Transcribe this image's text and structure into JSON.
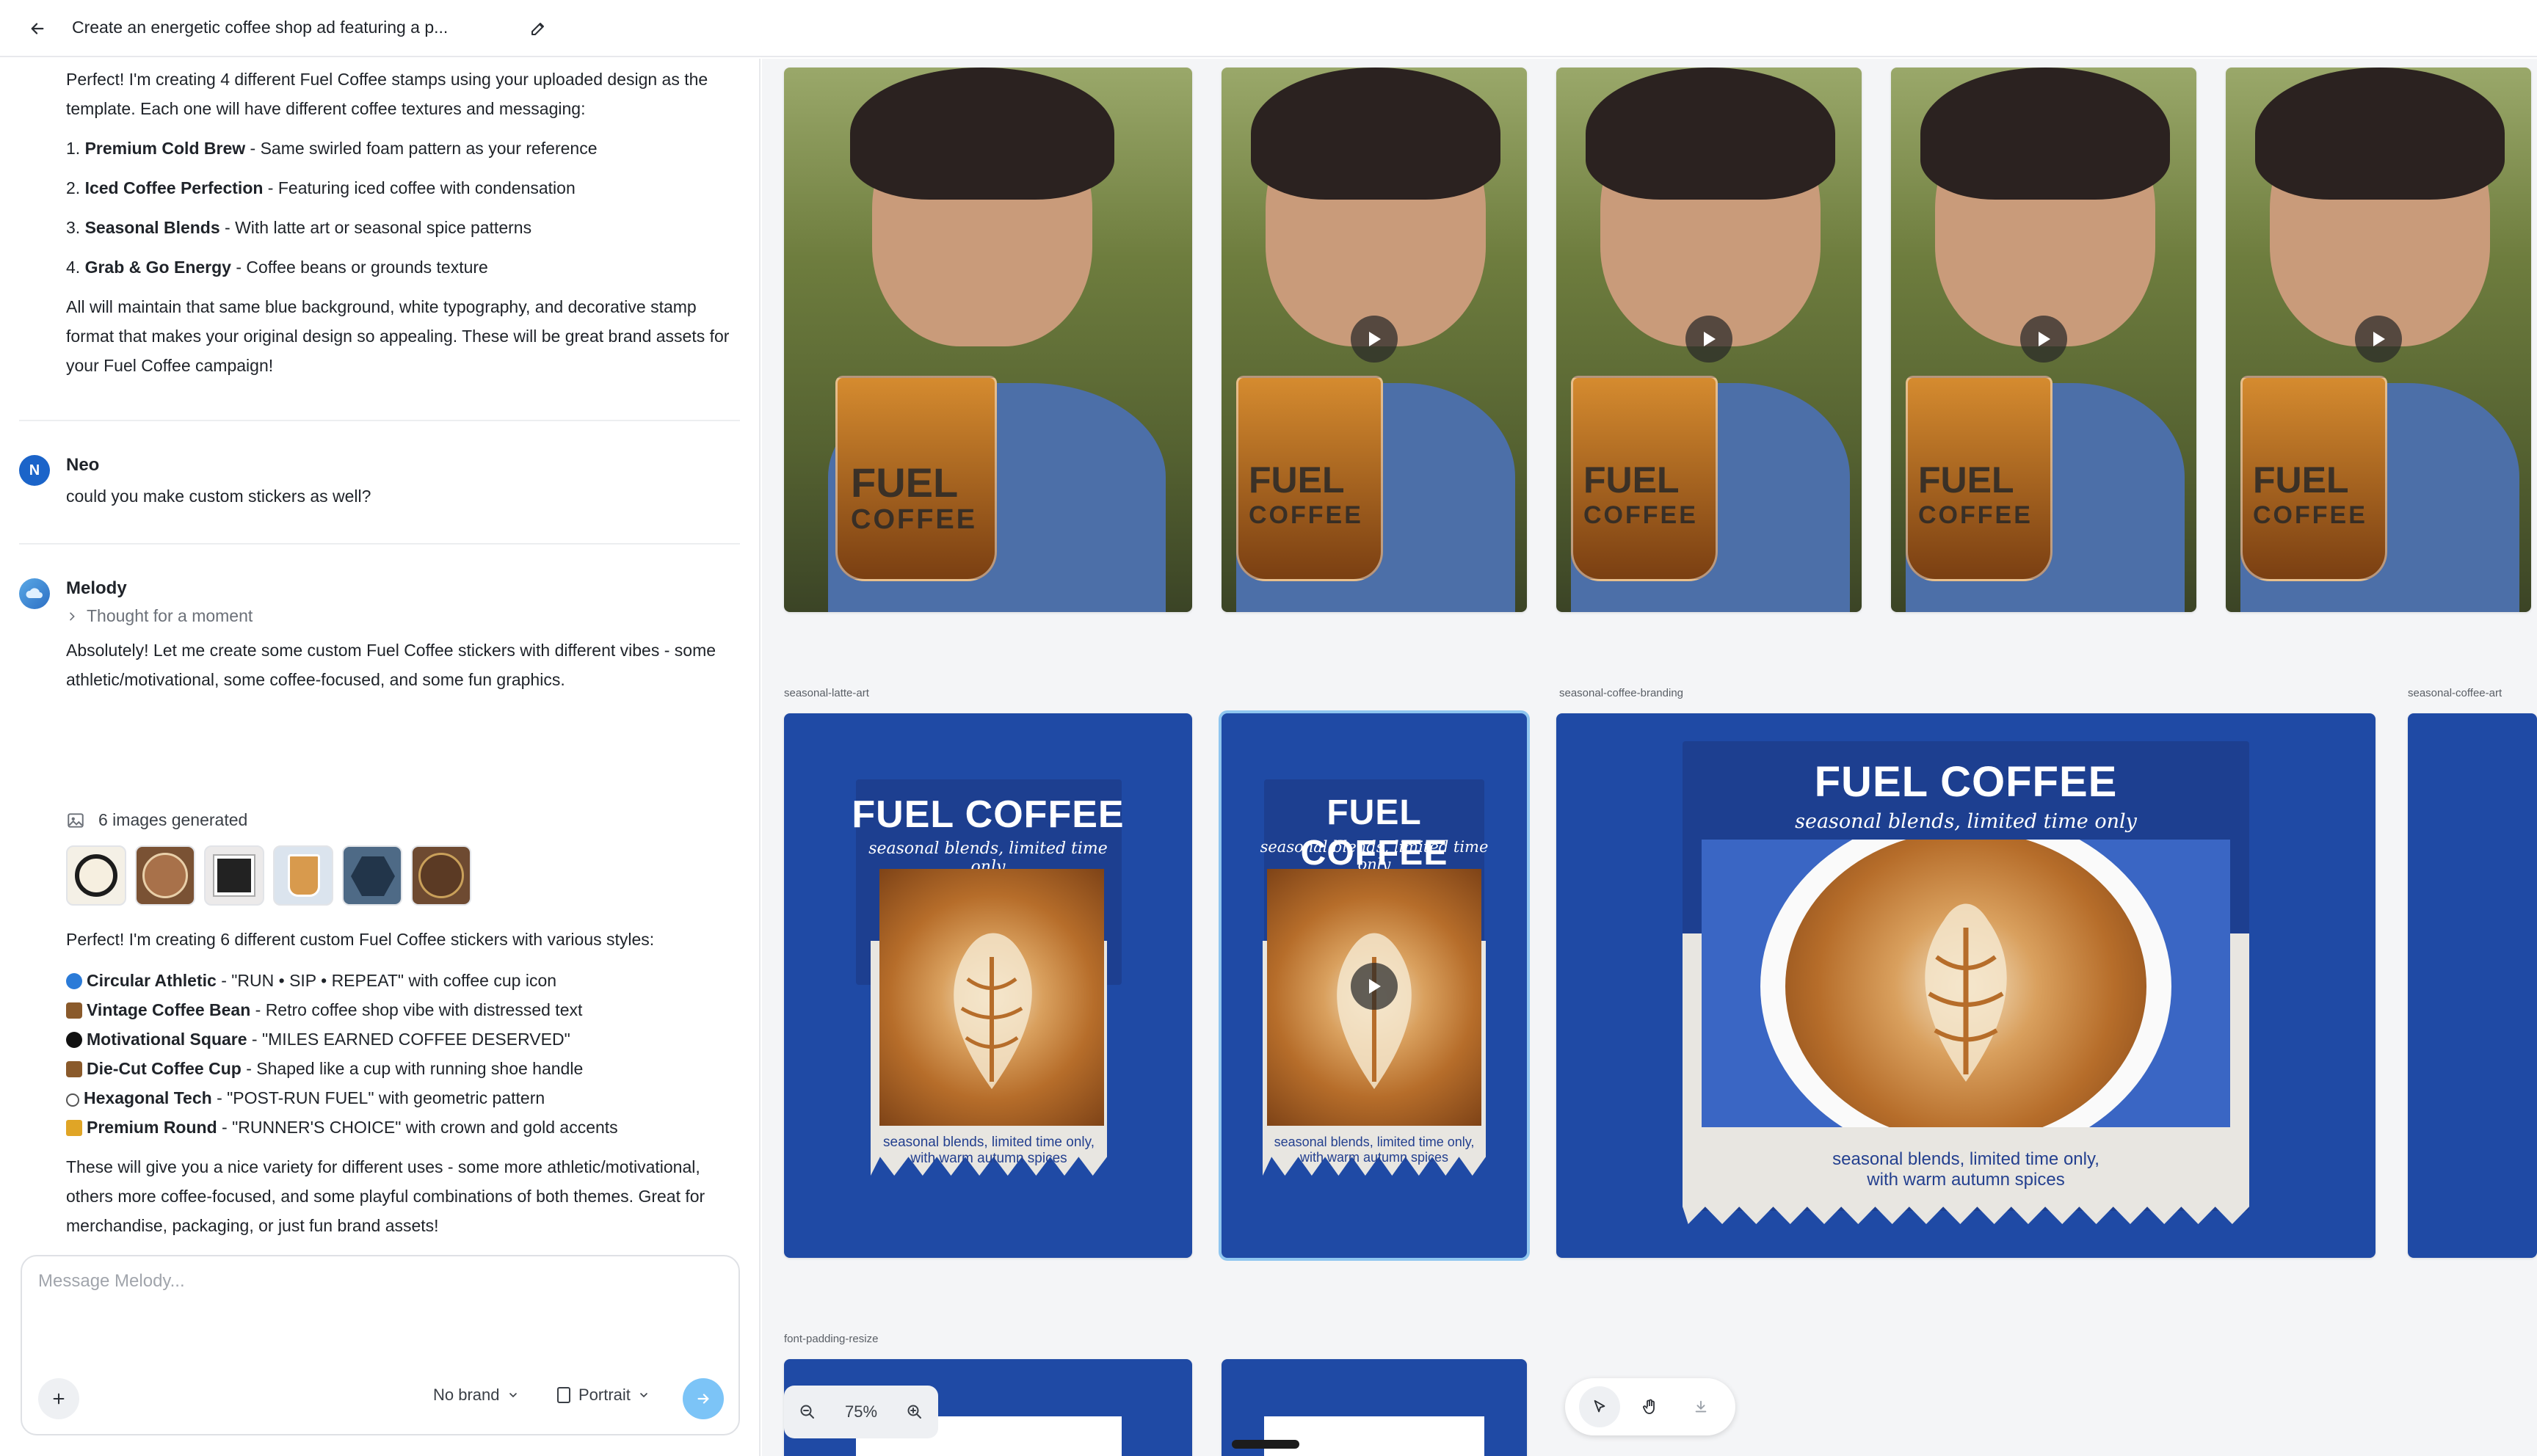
{
  "header": {
    "title": "Create an energetic coffee shop ad featuring a p..."
  },
  "chat": {
    "intro": {
      "text": "Perfect! I'm creating 4 different Fuel Coffee stamps using your uploaded design as the template. Each one will have different coffee textures and messaging:",
      "items": [
        {
          "num": "1.",
          "title": "Premium Cold Brew",
          "desc": " - Same swirled foam pattern as your reference"
        },
        {
          "num": "2.",
          "title": "Iced Coffee Perfection",
          "desc": " - Featuring iced coffee with condensation"
        },
        {
          "num": "3.",
          "title": "Seasonal Blends",
          "desc": " - With latte art or seasonal spice patterns"
        },
        {
          "num": "4.",
          "title": "Grab & Go Energy",
          "desc": " - Coffee beans or grounds texture"
        }
      ],
      "closing": "All will maintain that same blue background, white typography, and decorative stamp format that makes your original design so appealing. These will be great brand assets for your Fuel Coffee campaign!"
    },
    "user_msg": {
      "initial": "N",
      "name": "Neo",
      "text": "could you make custom stickers as well?"
    },
    "bot_msg": {
      "name": "Melody",
      "thought": "Thought for a moment",
      "text1": "Absolutely! Let me create some custom Fuel Coffee stickers with different vibes - some athletic/motivational, some coffee-focused, and some fun graphics.",
      "images_generated": "6 images generated",
      "text2": "Perfect! I'm creating 6 different custom Fuel Coffee stickers with various styles:",
      "stickers": [
        {
          "icon_color": "#2b7bd8",
          "title": "Circular Athletic",
          "desc": " - \"RUN • SIP • REPEAT\" with coffee cup icon"
        },
        {
          "icon_color": "#8a5a2b",
          "title": "Vintage Coffee Bean",
          "desc": " - Retro coffee shop vibe with distressed text"
        },
        {
          "icon_color": "#111111",
          "title": "Motivational Square",
          "desc": " - \"MILES EARNED COFFEE DESERVED\""
        },
        {
          "icon_color": "#8a5a2b",
          "title": "Die-Cut Coffee Cup",
          "desc": " - Shaped like a cup with running shoe handle"
        },
        {
          "icon_color": "#ffffff",
          "title": "Hexagonal Tech",
          "desc": " - \"POST-RUN FUEL\" with geometric pattern"
        },
        {
          "icon_color": "#e0a526",
          "title": "Premium Round",
          "desc": " - \"RUNNER'S CHOICE\" with crown and gold accents"
        }
      ],
      "text3": "These will give you a nice variety for different uses - some more athletic/motivational, others more coffee-focused, and some playful combinations of both themes. Great for merchandise, packaging, or just fun brand assets!"
    }
  },
  "composer": {
    "placeholder": "Message Melody...",
    "brand": "No brand",
    "orientation": "Portrait"
  },
  "canvas": {
    "photo_cup_text": [
      "FUEL",
      "COFFEE"
    ],
    "labels": {
      "row2_a": "seasonal-latte-art",
      "row2_b": "seasonal-coffee-branding",
      "row2_c": "seasonal-coffee-art",
      "row3_a": "font-padding-resize"
    },
    "stamp": {
      "title": "FUEL COFFEE",
      "subtitle": "seasonal blends, limited time only",
      "paper_text_l1": "seasonal blends, limited time only,",
      "paper_text_l2": "with warm autumn spices"
    },
    "zoom": "75%"
  },
  "colors": {
    "accent_blue": "#1f4aa5",
    "send_button": "#7cc4f7",
    "user_avatar": "#1b64c9"
  }
}
